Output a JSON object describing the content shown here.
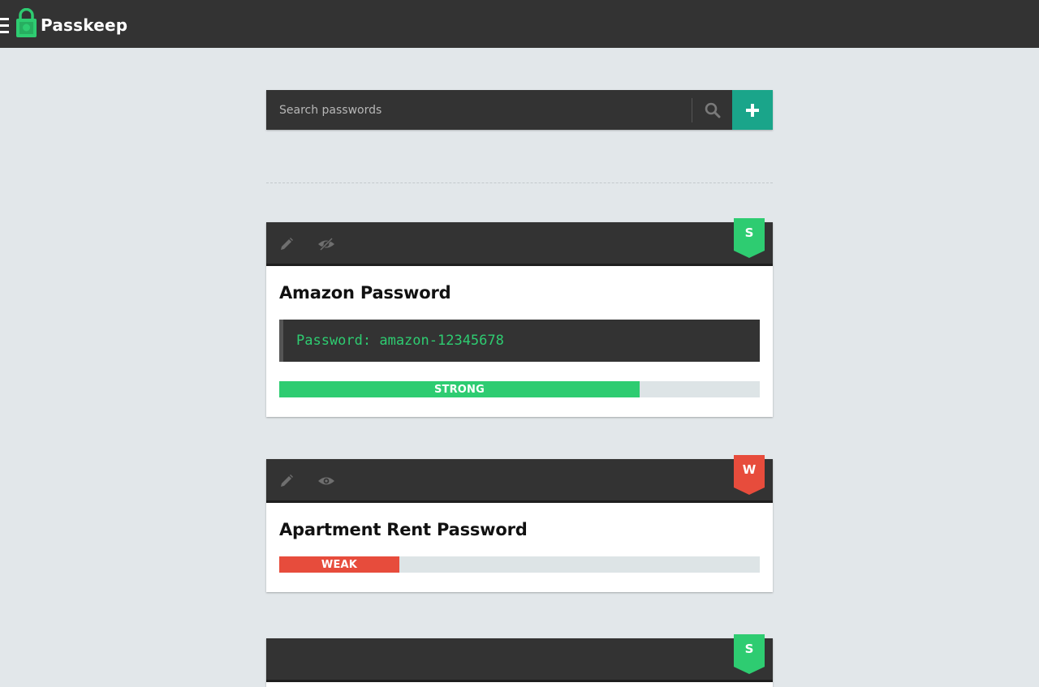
{
  "app": {
    "brand": "Passkeep"
  },
  "colors": {
    "topbar": "#333333",
    "background": "#e2e7ea",
    "accent": "#1aa58a",
    "strong": "#2ecc71",
    "weak": "#e74c3c",
    "track": "#dde4e6"
  },
  "search": {
    "placeholder": "Search passwords",
    "value": ""
  },
  "icons": {
    "menu": "hamburger-icon",
    "logo": "padlock-icon",
    "search": "magnifier-icon",
    "add": "plus-icon",
    "edit": "pencil-icon",
    "hide": "eye-slash-icon",
    "show": "eye-icon"
  },
  "cards": [
    {
      "title": "Amazon Password",
      "badge": "S",
      "badge_color": "#2ecc71",
      "password": "Password: amazon-12345678",
      "strength_label": "STRONG",
      "strength_color": "#2ecc71",
      "strength_fraction": 0.75,
      "password_visible": true
    },
    {
      "title": "Apartment Rent Password",
      "badge": "W",
      "badge_color": "#e74c3c",
      "strength_label": "WEAK",
      "strength_color": "#e74c3c",
      "strength_fraction": 0.25,
      "password_visible": false
    },
    {
      "badge": "S",
      "badge_color": "#2ecc71"
    }
  ]
}
